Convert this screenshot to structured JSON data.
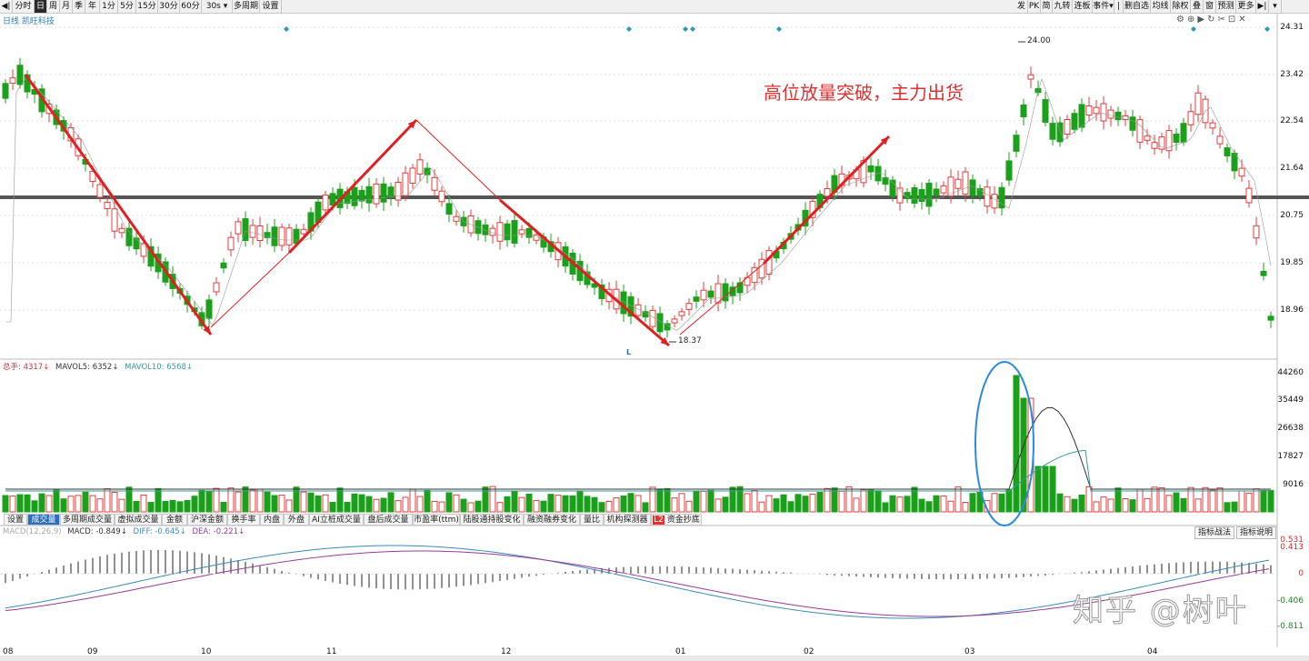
{
  "toolbar": {
    "left": [
      "分时",
      "日",
      "周",
      "月",
      "季",
      "年",
      "1分",
      "5分",
      "15分",
      "30分",
      "60分",
      "30s",
      "多周期",
      "设置"
    ],
    "right": [
      "发",
      "PK",
      "简",
      "九转",
      "连板",
      "事件",
      "删自选",
      "均线",
      "除权",
      "叠",
      "窗",
      "预测",
      "更多"
    ],
    "selected": "日"
  },
  "chart_title": "日线  凯旺科技",
  "annotation": "高位放量突破，主力出货",
  "price_axis": [
    "24.31",
    "23.42",
    "22.54",
    "21.64",
    "20.75",
    "19.85",
    "18.96"
  ],
  "high_label": "24.00",
  "low_label": "18.37",
  "low_marker": "L",
  "volume_legend": {
    "total": "总手: 4317↓",
    "ma5": "MAVOL5: 6352↓",
    "ma10": "MAVOL10: 6568↓"
  },
  "volume_axis": [
    "44260",
    "35449",
    "26638",
    "17827",
    "9016"
  ],
  "tabs": [
    "设置",
    "成交量",
    "多周期成交量",
    "虚拟成交量",
    "金额",
    "沪深金额",
    "换手率",
    "内盘",
    "外盘",
    "AI立桩成交量",
    "盘后成交量",
    "市盈率(ttm)",
    "陆股通持股变化",
    "融资融券变化",
    "量比",
    "机构探测器",
    "资金抄底"
  ],
  "tab_selected": "成交量",
  "macd_legend": {
    "name": "MACD(12,26,9)",
    "macd": "MACD: -0.849↓",
    "diff": "DIFF: -0.645↓",
    "dea": "DEA: -0.221↓"
  },
  "macd_buttons": [
    "指标战法",
    "指标说明"
  ],
  "macd_axis": [
    "0.531",
    "0.413",
    "0",
    "-0.406",
    "-0.811"
  ],
  "months": [
    "08",
    "09",
    "10",
    "11",
    "12",
    "01",
    "02",
    "03",
    "04"
  ],
  "watermark": "知乎 @树叶",
  "colors": {
    "up": "#e03c3c",
    "down": "#1aa01a",
    "accent": "#2b6fc0",
    "annotation": "#e03030"
  }
}
